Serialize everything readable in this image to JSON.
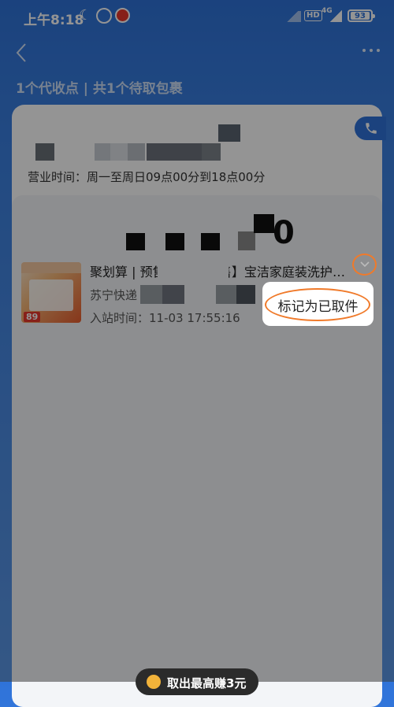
{
  "status_bar": {
    "time": "上午8:18",
    "battery": "93",
    "network": "4G",
    "hd": "HD"
  },
  "nav": {
    "back_icon": "chevron-left-icon",
    "more_icon": "more-dots-icon"
  },
  "summary": {
    "count_text": "1个代收点 | 共1个待取包裹"
  },
  "station": {
    "hours": "营业时间：周一至周日09点00分到18点00分",
    "phone_icon": "phone-icon"
  },
  "parcel": {
    "title": "聚划算 | 预售【双11预售】宝洁家庭装洗护组合",
    "courier": "苏宁快递",
    "in_time": "入站时间：11-03 17:55:16",
    "thumb_price": "89"
  },
  "popup": {
    "mark_picked": "标记为已取件"
  },
  "bottom": {
    "promo": "取出最高赚3元"
  },
  "colors": {
    "brand_blue": "#2f73d9",
    "annotation_orange": "#f07a2a"
  }
}
